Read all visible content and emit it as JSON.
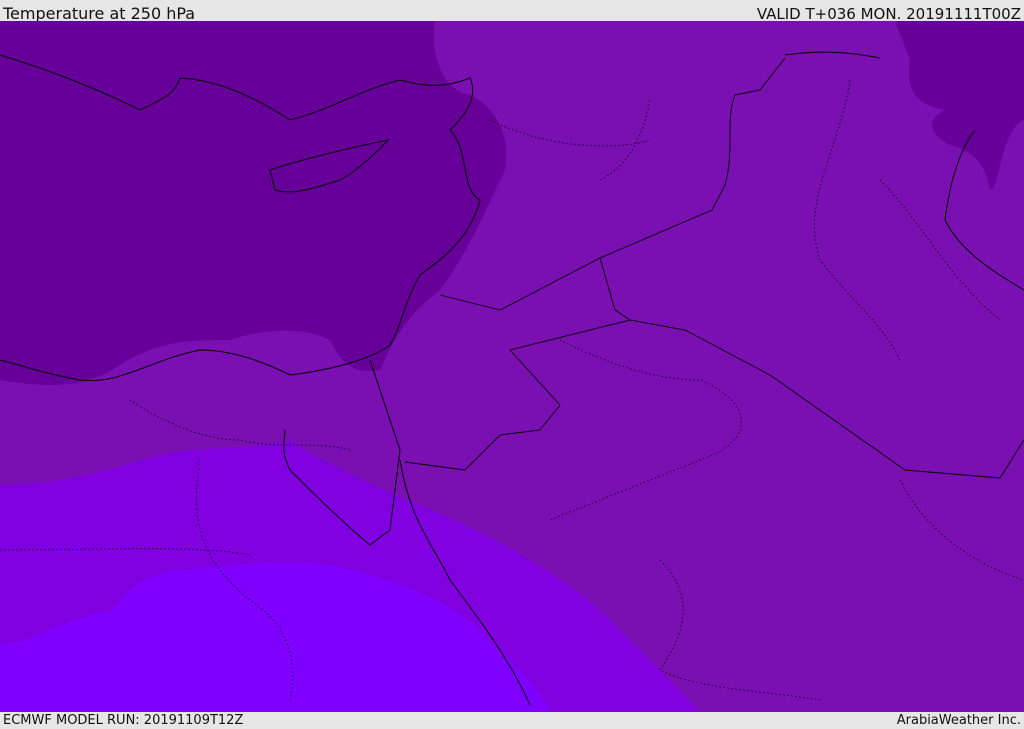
{
  "header": {
    "title": "Temperature at 250 hPa",
    "valid": "VALID T+036 MON. 20191111T00Z"
  },
  "footer": {
    "model_run": "ECMWF MODEL RUN: 20191109T12Z",
    "credit": "ArabiaWeather Inc."
  },
  "map": {
    "field": "temperature",
    "level": "250 hPa",
    "colors": {
      "coldest": "#660099",
      "cold": "#7a10b2",
      "mild": "#8000e0",
      "warm": "#8000ff",
      "coastline": "#000000"
    }
  }
}
